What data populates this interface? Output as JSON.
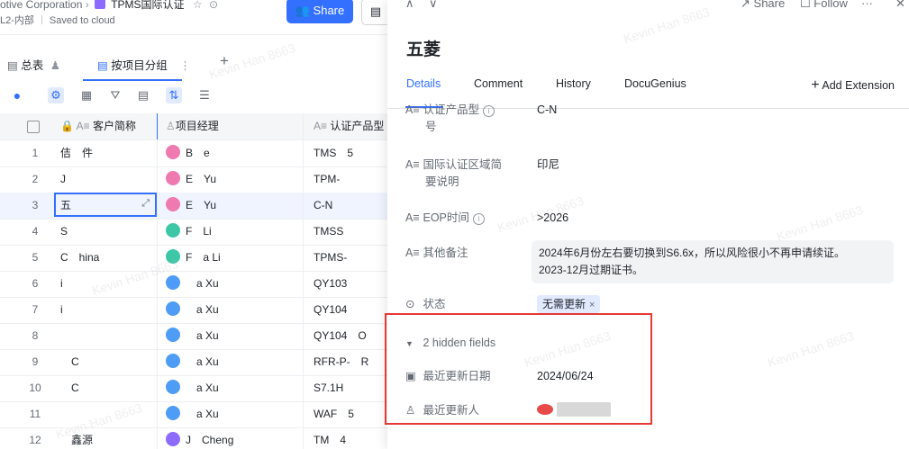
{
  "header": {
    "company": "otive Corporation",
    "doc_title": "TPMS国际认证",
    "breadcrumb": "L2-内部",
    "saved_status": "Saved to cloud",
    "share_label": "Share"
  },
  "view_tabs": {
    "tab1": "总表",
    "tab2": "按项目分组",
    "add": "+"
  },
  "table": {
    "columns": [
      "客户简称",
      "项目经理",
      "认证产品型"
    ],
    "rows": [
      {
        "num": "1",
        "cust": "佶　件",
        "pm": "B　e",
        "prod": "TMS　5",
        "color": "#ee7ab0"
      },
      {
        "num": "2",
        "cust": "J",
        "pm": "E　Yu",
        "prod": "TPM-",
        "color": "#ee7ab0"
      },
      {
        "num": "3",
        "cust": "五",
        "pm": "E　Yu",
        "prod": "C-N",
        "color": "#ee7ab0"
      },
      {
        "num": "4",
        "cust": "S",
        "pm": "F　Li",
        "prod": "TMSS",
        "color": "#3ec7a7"
      },
      {
        "num": "5",
        "cust": "C　hina",
        "pm": "F　a Li",
        "prod": "TPMS-",
        "color": "#3ec7a7"
      },
      {
        "num": "6",
        "cust": "i",
        "pm": "　a Xu",
        "prod": "QY103",
        "color": "#4e9cf5"
      },
      {
        "num": "7",
        "cust": "i",
        "pm": "　a Xu",
        "prod": "QY104",
        "color": "#4e9cf5"
      },
      {
        "num": "8",
        "cust": "",
        "pm": "　a Xu",
        "prod": "QY104　O",
        "color": "#4e9cf5"
      },
      {
        "num": "9",
        "cust": "　C",
        "pm": "　a Xu",
        "prod": "RFR-P-　R",
        "color": "#4e9cf5"
      },
      {
        "num": "10",
        "cust": "　C",
        "pm": "　a Xu",
        "prod": "S7.1H",
        "color": "#4e9cf5"
      },
      {
        "num": "11",
        "cust": "",
        "pm": "　a Xu",
        "prod": "WAF　5",
        "color": "#4e9cf5"
      },
      {
        "num": "12",
        "cust": "　鑫源",
        "pm": "J　Cheng",
        "prod": "TM　4",
        "color": "#8e6bff"
      }
    ]
  },
  "panel": {
    "share_label": "Share",
    "follow_label": "Follow",
    "record_title": "五菱",
    "tabs": [
      "Details",
      "Comment",
      "History",
      "DocuGenius"
    ],
    "add_extension": "Add Extension",
    "fields": {
      "product_label": "认证产品型",
      "product_label2": "号",
      "product_value": "C-N",
      "region_label": "国际认证区域简",
      "region_label2": "要说明",
      "region_value": "印尼",
      "eop_label": "EOP时间",
      "eop_value": ">2026",
      "notes_label": "其他备注",
      "notes_line1": "2024年6月份左右要切换到S6.6x，所以风险很小不再申请续证。",
      "notes_line2": "2023-12月过期证书。",
      "status_label": "状态",
      "status_value": "无需更新",
      "hidden_fields": "2 hidden fields",
      "updated_date_label": "最近更新日期",
      "updated_date_value": "2024/06/24",
      "updated_by_label": "最近更新人"
    }
  },
  "watermark": "Kevin Han 8663"
}
